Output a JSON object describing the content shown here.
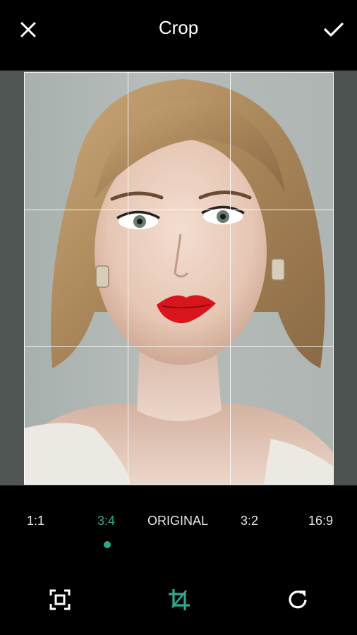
{
  "header": {
    "title": "Crop",
    "close_icon": "close-icon",
    "confirm_icon": "check-icon"
  },
  "aspect_ratios": {
    "options": [
      "1:1",
      "3:4",
      "ORIGINAL",
      "3:2",
      "16:9"
    ],
    "selected": "3:4"
  },
  "toolbar": {
    "tools": [
      "fit-frame-icon",
      "crop-icon",
      "rotate-icon"
    ],
    "active_tool": "crop-icon"
  },
  "colors": {
    "accent": "#2fa98c",
    "background": "#000000",
    "text": "#ffffff"
  }
}
